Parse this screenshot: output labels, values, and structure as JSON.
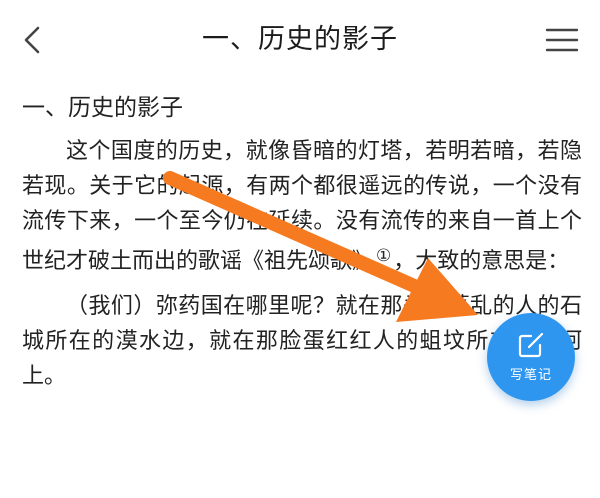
{
  "header": {
    "title": "一、历史的影子",
    "back_icon": "chevron-left-icon",
    "menu_icon": "hamburger-menu-icon"
  },
  "content": {
    "section_title": "一、历史的影子",
    "paragraph1_a": "这个国度的历史，就像昏暗的灯塔，若明若暗，若隐若现。关于它的起源，有两个都很遥远的传说，一个没有流传下来，一个至今仍在延续。没有流传的来自一首上个世纪才破土而出的歌谣《祖先颂歌》",
    "footnote_marker": "①",
    "paragraph1_b": "，大致的意思是：",
    "paragraph2": "（我们）弥药国在哪里呢？就在那头发蓬乱的人的石城所在的漠水边，就在那脸蛋红红人的蛆坟所在的白河上。"
  },
  "fab": {
    "label": "写笔记",
    "icon": "edit-note-icon"
  },
  "colors": {
    "fab": "#2f96f0",
    "arrow": "#f57a20",
    "text": "#222222"
  }
}
